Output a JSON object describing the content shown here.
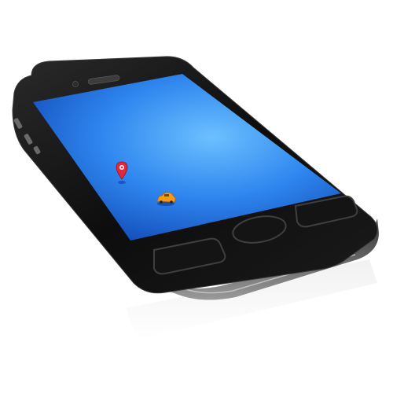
{
  "scene": {
    "subject": "smartphone-on-white",
    "background_color": "#ffffff"
  },
  "phone": {
    "body_color": "#111111",
    "bezel_color": "#2a2a2a",
    "metal_band_color": "#8a8a8a",
    "screen": {
      "gradient_center_color": "#5fb4ff",
      "gradient_edge_color": "#0b3fb0"
    },
    "map_pin": {
      "icon": "map-pin-icon",
      "color": "#e0283c"
    },
    "car": {
      "icon": "taxi-car-icon",
      "color": "#f39a14"
    },
    "buttons": {
      "home_button_icon": "home-button-icon",
      "left_soft_key_icon": "soft-key-icon",
      "right_soft_key_icon": "soft-key-icon",
      "speaker_icon": "speaker-grille-icon",
      "camera_icon": "front-camera-icon",
      "volume_icon": "volume-button-icon"
    }
  }
}
